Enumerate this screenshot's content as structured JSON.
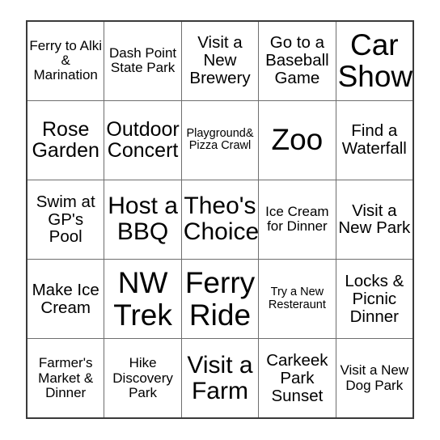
{
  "card": {
    "type": "bingo-card",
    "rows": 5,
    "columns": 5,
    "text_color": "#000000",
    "cell_background": "#ffffff",
    "grid_line_color": "#6e6e6e",
    "outer_border_color": "#3a3a3a",
    "page_background": "#ffffff"
  },
  "cells": [
    [
      {
        "text": "Ferry to Alki & Marination",
        "size": "sm"
      },
      {
        "text": "Dash Point State Park",
        "size": "sm"
      },
      {
        "text": "Visit a New Brewery",
        "size": "md"
      },
      {
        "text": "Go to a Baseball Game",
        "size": "md"
      },
      {
        "text": "Car Show",
        "size": "xxl"
      }
    ],
    [
      {
        "text": "Rose Garden",
        "size": "lg"
      },
      {
        "text": "Outdoor Concert",
        "size": "lg"
      },
      {
        "text": "Playground& Pizza Crawl",
        "size": "xs"
      },
      {
        "text": "Zoo",
        "size": "xxl"
      },
      {
        "text": "Find a Waterfall",
        "size": "md"
      }
    ],
    [
      {
        "text": "Swim at GP's Pool",
        "size": "md"
      },
      {
        "text": "Host a BBQ",
        "size": "xl"
      },
      {
        "text": "Theo's Choice",
        "size": "xl"
      },
      {
        "text": "Ice Cream for Dinner",
        "size": "sm"
      },
      {
        "text": "Visit a New Park",
        "size": "md"
      }
    ],
    [
      {
        "text": "Make Ice Cream",
        "size": "md"
      },
      {
        "text": "NW Trek",
        "size": "xxl"
      },
      {
        "text": "Ferry Ride",
        "size": "xxl"
      },
      {
        "text": "Try a New Resteraunt",
        "size": "xs"
      },
      {
        "text": "Locks & Picnic Dinner",
        "size": "md"
      }
    ],
    [
      {
        "text": "Farmer's Market & Dinner",
        "size": "sm"
      },
      {
        "text": "Hike Discovery Park",
        "size": "sm"
      },
      {
        "text": "Visit a Farm",
        "size": "xl"
      },
      {
        "text": "Carkeek Park Sunset",
        "size": "md"
      },
      {
        "text": "Visit a New Dog Park",
        "size": "sm"
      }
    ]
  ]
}
